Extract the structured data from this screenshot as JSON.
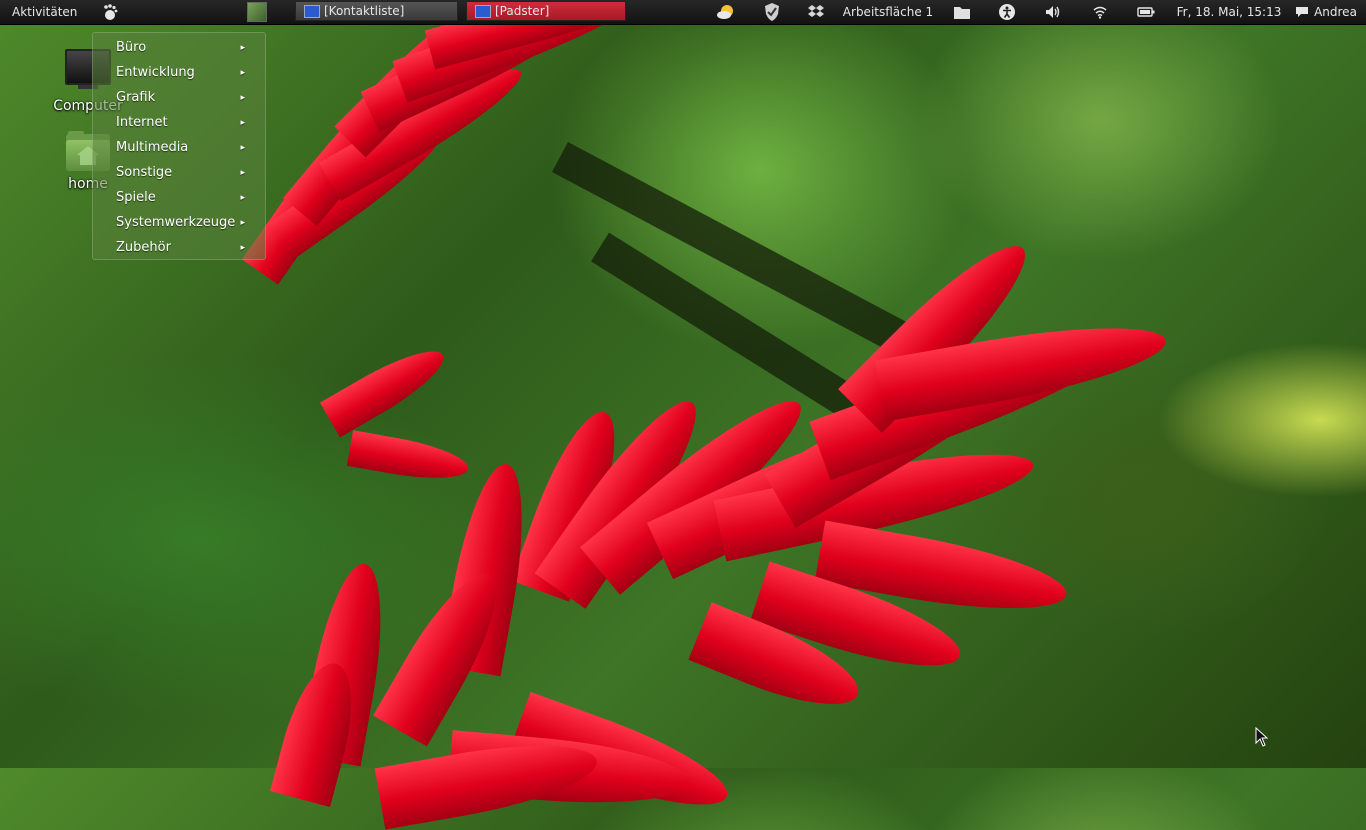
{
  "panel": {
    "activities": "Aktivitäten",
    "tasks": [
      {
        "label": "[Kontaktliste]",
        "active": false
      },
      {
        "label": "[Padster]",
        "active": true
      }
    ],
    "workspace": "Arbeitsfläche 1",
    "clock": "Fr, 18. Mai, 15:13",
    "user": "Andrea"
  },
  "desktop": {
    "icons": [
      {
        "label": "Computer"
      },
      {
        "label": "home"
      }
    ]
  },
  "menu": {
    "items": [
      {
        "label": "Büro"
      },
      {
        "label": "Entwicklung"
      },
      {
        "label": "Grafik"
      },
      {
        "label": "Internet"
      },
      {
        "label": "Multimedia"
      },
      {
        "label": "Sonstige"
      },
      {
        "label": "Spiele"
      },
      {
        "label": "Systemwerkzeuge"
      },
      {
        "label": "Zubehör"
      }
    ],
    "submenu_arrow": "▸"
  },
  "colors": {
    "panel_bg": "#1c1c1c",
    "active_task": "#c2202f",
    "flower_red": "#e0001c",
    "foliage_green": "#3e7526"
  }
}
